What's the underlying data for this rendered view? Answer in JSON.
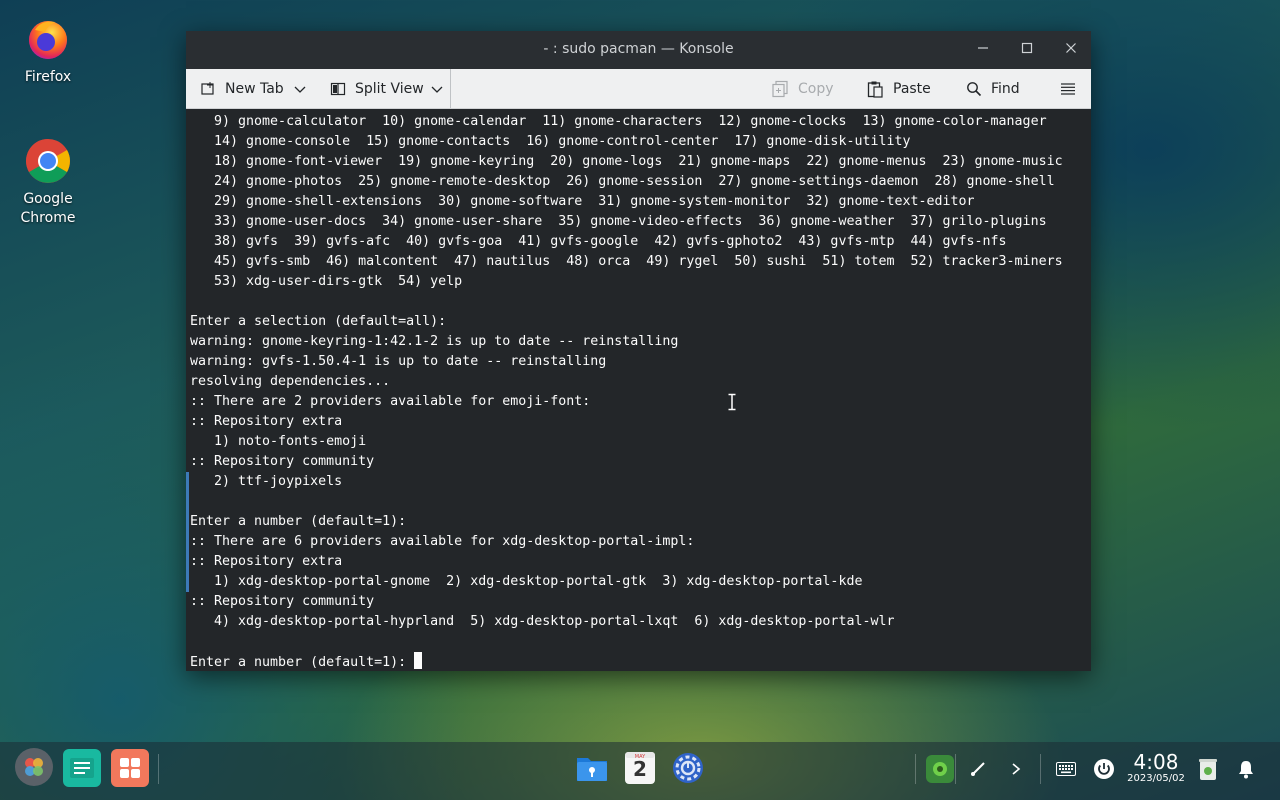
{
  "desktop": {
    "icons": [
      {
        "label": "Firefox"
      },
      {
        "label": "Google\nChrome"
      }
    ]
  },
  "window": {
    "title": "- : sudo pacman — Konsole",
    "toolbar": {
      "new_tab": "New Tab",
      "split_view": "Split View",
      "copy": "Copy",
      "paste": "Paste",
      "find": "Find"
    }
  },
  "terminal": {
    "lines": [
      "   9) gnome-calculator  10) gnome-calendar  11) gnome-characters  12) gnome-clocks  13) gnome-color-manager",
      "   14) gnome-console  15) gnome-contacts  16) gnome-control-center  17) gnome-disk-utility",
      "   18) gnome-font-viewer  19) gnome-keyring  20) gnome-logs  21) gnome-maps  22) gnome-menus  23) gnome-music",
      "   24) gnome-photos  25) gnome-remote-desktop  26) gnome-session  27) gnome-settings-daemon  28) gnome-shell",
      "   29) gnome-shell-extensions  30) gnome-software  31) gnome-system-monitor  32) gnome-text-editor",
      "   33) gnome-user-docs  34) gnome-user-share  35) gnome-video-effects  36) gnome-weather  37) grilo-plugins",
      "   38) gvfs  39) gvfs-afc  40) gvfs-goa  41) gvfs-google  42) gvfs-gphoto2  43) gvfs-mtp  44) gvfs-nfs",
      "   45) gvfs-smb  46) malcontent  47) nautilus  48) orca  49) rygel  50) sushi  51) totem  52) tracker3-miners",
      "   53) xdg-user-dirs-gtk  54) yelp",
      "",
      "Enter a selection (default=all):",
      "warning: gnome-keyring-1:42.1-2 is up to date -- reinstalling",
      "warning: gvfs-1.50.4-1 is up to date -- reinstalling",
      "resolving dependencies...",
      ":: There are 2 providers available for emoji-font:",
      ":: Repository extra",
      "   1) noto-fonts-emoji",
      ":: Repository community",
      "   2) ttf-joypixels",
      "",
      "Enter a number (default=1):",
      ":: There are 6 providers available for xdg-desktop-portal-impl:",
      ":: Repository extra",
      "   1) xdg-desktop-portal-gnome  2) xdg-desktop-portal-gtk  3) xdg-desktop-portal-kde",
      ":: Repository community",
      "   4) xdg-desktop-portal-hyprland  5) xdg-desktop-portal-lxqt  6) xdg-desktop-portal-wlr",
      ""
    ],
    "prompt": "Enter a number (default=1): "
  },
  "taskbar": {
    "calendar_month": "MAY",
    "calendar_day": "2",
    "clock_time": "4:08",
    "clock_date": "2023/05/02"
  },
  "colors": {
    "terminal_bg": "#232629",
    "terminal_fg": "#fcfcfc",
    "toolbar_bg": "#eff0f1",
    "titlebar_bg": "#2a2e32",
    "selection_marker": "#3d7ab8"
  }
}
